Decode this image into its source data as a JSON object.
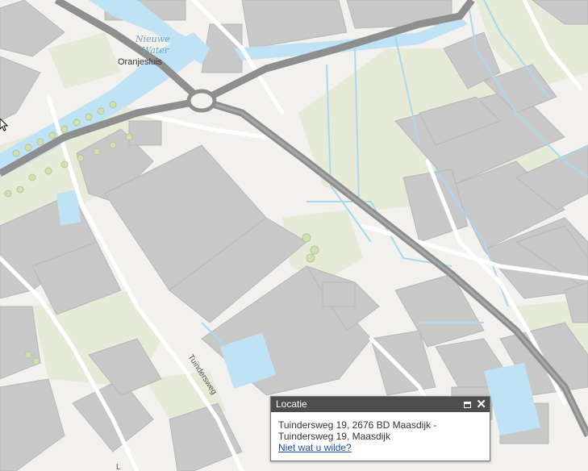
{
  "map": {
    "water_label_line1": "Nieuwe",
    "water_label_line2": "Water",
    "place_label": "Oranjesluis",
    "street_label": "Tuindersweg",
    "street_label_partial": "L"
  },
  "popup": {
    "title": "Locatie",
    "address_line1": "Tuindersweg 19, 2676 BD Maasdijk -",
    "address_line2": "Tuindersweg 19, Maasdijk",
    "link": "Niet wat u wilde?"
  },
  "colors": {
    "background": "#f2f1ee",
    "building": "#c8c8c8",
    "water": "#bfe3f4",
    "park": "#e6ebd7",
    "major_road": "#9a9a9a",
    "popup_header": "#4d4d4d",
    "link": "#1a4fb5"
  }
}
